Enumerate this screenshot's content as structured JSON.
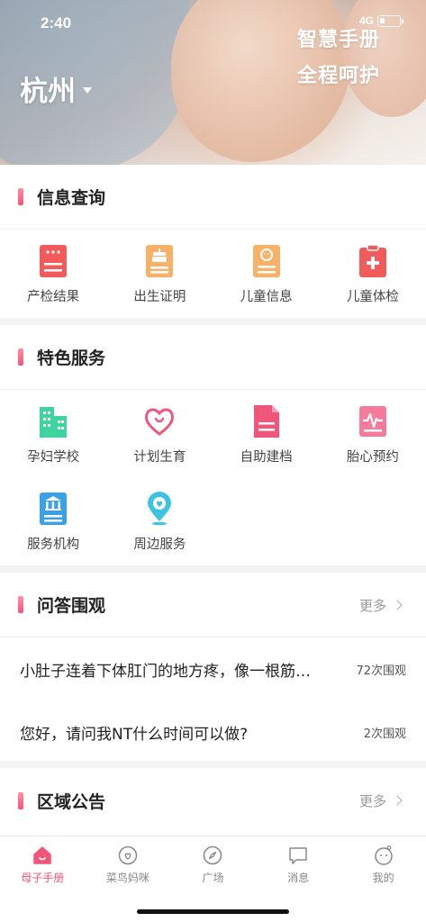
{
  "status_bar": {
    "time": "2:40",
    "network": "4G"
  },
  "hero": {
    "city": "杭州",
    "slogan_line1": "智慧手册",
    "slogan_line2": "全程呵护"
  },
  "colors": {
    "accent": "#f0567a",
    "red": "#f25b5b",
    "orange": "#f7b267",
    "green": "#3fd3a0",
    "blue": "#3aa0e8",
    "pink": "#f57a9b"
  },
  "info_section": {
    "title": "信息查询",
    "items": [
      {
        "label": "产检结果",
        "icon": "report-icon"
      },
      {
        "label": "出生证明",
        "icon": "cake-certificate-icon"
      },
      {
        "label": "儿童信息",
        "icon": "child-profile-icon"
      },
      {
        "label": "儿童体检",
        "icon": "medical-clipboard-icon"
      }
    ]
  },
  "special_section": {
    "title": "特色服务",
    "items": [
      {
        "label": "孕妇学校",
        "icon": "school-building-icon"
      },
      {
        "label": "计划生育",
        "icon": "heart-icon"
      },
      {
        "label": "自助建档",
        "icon": "document-icon"
      },
      {
        "label": "胎心预约",
        "icon": "heartbeat-icon"
      },
      {
        "label": "服务机构",
        "icon": "institution-icon"
      },
      {
        "label": "周边服务",
        "icon": "location-pin-icon"
      }
    ]
  },
  "qa_section": {
    "title": "问答围观",
    "more": "更多",
    "items": [
      {
        "text": "小肚子连着下体肛门的地方疼，像一根筋…",
        "count": "72次围观"
      },
      {
        "text": "您好，请问我NT什么时间可以做?",
        "count": "2次围观"
      }
    ]
  },
  "notice_section": {
    "title": "区域公告",
    "more": "更多"
  },
  "tabbar": {
    "tabs": [
      {
        "label": "母子手册",
        "icon": "home-icon",
        "active": true
      },
      {
        "label": "菜鸟妈咪",
        "icon": "chat-heart-icon",
        "active": false
      },
      {
        "label": "广场",
        "icon": "compass-icon",
        "active": false
      },
      {
        "label": "消息",
        "icon": "message-icon",
        "active": false
      },
      {
        "label": "我的",
        "icon": "baby-face-icon",
        "active": false
      }
    ]
  }
}
